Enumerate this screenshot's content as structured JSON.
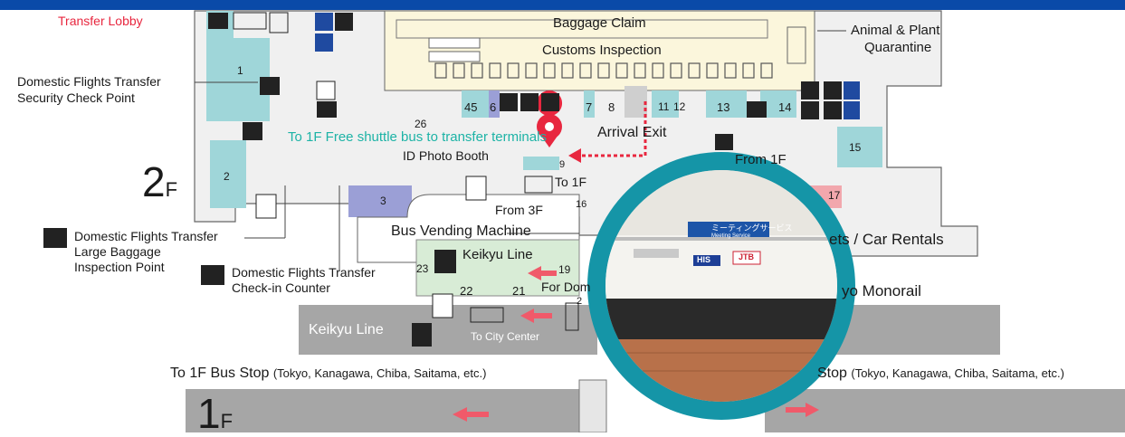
{
  "colors": {
    "top_bar": "#0a4aa8",
    "teal_area": "#9fd6d9",
    "baggage_area": "#fbf6dc",
    "gray_corridor": "#a6a6a6",
    "light_gray": "#ececec",
    "purple": "#9b9fd6",
    "pink": "#f2a7ad",
    "green": "#d8ecd6",
    "accent_red": "#e8273f",
    "ring": "#1595a7"
  },
  "header": {
    "transfer_lobby": "Transfer Lobby"
  },
  "labels": {
    "baggage_claim": "Baggage Claim",
    "customs": "Customs Inspection",
    "quarantine_1": "Animal & Plant",
    "quarantine_2": "Quarantine",
    "dom_security_1": "Domestic Flights Transfer",
    "dom_security_2": "Security Check Point",
    "shuttle": "To 1F Free shuttle bus to transfer terminals",
    "arrival_exit": "Arrival Exit",
    "id_photo": "ID Photo Booth",
    "from_1f": "From 1F",
    "to_1f": "To 1F",
    "from_3f": "From 3F",
    "bus_vending": "Bus Vending Machine",
    "keikyu_line_2f": "Keikyu Line",
    "large_baggage_1": "Domestic Flights Transfer",
    "large_baggage_2": "Large Baggage",
    "large_baggage_3": "Inspection Point",
    "checkin_1": "Domestic Flights Transfer",
    "checkin_2": "Check-in Counter",
    "for_dom": "For Dom",
    "tickets": "ets / Car Rentals",
    "monorail": "yo Monorail",
    "keikyu_line_1f": "Keikyu Line",
    "to_city_center": "To City Center",
    "bus_stop_left_main": "To 1F Bus Stop",
    "bus_stop_left_sub": "(Tokyo, Kanagawa, Chiba, Saitama, etc.)",
    "bus_stop_right_main": "Stop",
    "bus_stop_right_sub": "(Tokyo, Kanagawa, Chiba, Saitama, etc.)",
    "floor_2": "2",
    "floor_2_suffix": "F",
    "floor_1": "1",
    "floor_1_suffix": "F"
  },
  "area_numbers": {
    "n1": "1",
    "n2": "2",
    "n3": "3",
    "n7": "7",
    "n8": "8",
    "n9": "9",
    "n11": "11",
    "n12": "12",
    "n13": "13",
    "n14": "14",
    "n15": "15",
    "n17": "17",
    "n19": "19",
    "n21": "21",
    "n22": "22",
    "n23": "23",
    "n26": "26",
    "n45": "45",
    "n6": "6",
    "n16": "16",
    "n2b": "2"
  },
  "photo": {
    "sign_text": "ミーティングサービス",
    "sign_sub": "Meeting Service",
    "brand_1": "HIS",
    "brand_2": "JTB"
  }
}
